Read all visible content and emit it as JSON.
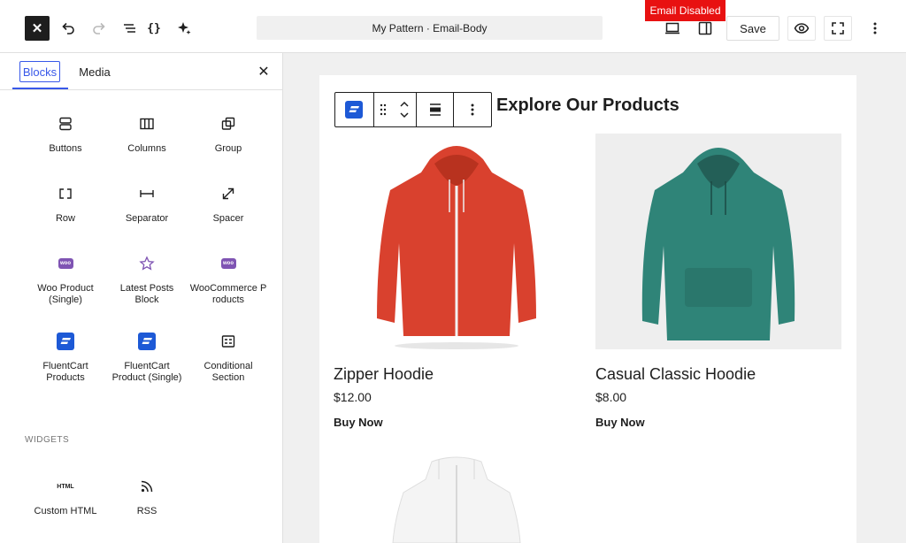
{
  "topbar": {
    "close_icon": "close-icon",
    "undo_icon": "undo-icon",
    "redo_icon": "redo-icon",
    "list_view_icon": "list-view-icon",
    "code_icon": "code-icon",
    "ai_icon": "sparkle-icon",
    "document_title": "My Pattern · Email-Body",
    "email_status": "Email Disabled",
    "save_label": "Save",
    "accent": "#3858e9",
    "status_color": "#e81111"
  },
  "sidebar": {
    "tabs": [
      {
        "label": "Blocks",
        "active": true
      },
      {
        "label": "Media",
        "active": false
      }
    ],
    "blocks": [
      {
        "label": "Buttons",
        "icon": "buttons-icon"
      },
      {
        "label": "Columns",
        "icon": "columns-icon"
      },
      {
        "label": "Group",
        "icon": "group-icon"
      },
      {
        "label": "Row",
        "icon": "row-icon"
      },
      {
        "label": "Separator",
        "icon": "separator-icon"
      },
      {
        "label": "Spacer",
        "icon": "spacer-icon"
      },
      {
        "label": "Woo Product (Single)",
        "icon": "woo-icon"
      },
      {
        "label": "Latest Posts Block",
        "icon": "star-icon"
      },
      {
        "label": "WooCommerce Products",
        "icon": "woo-icon"
      },
      {
        "label": "FluentCart Products",
        "icon": "fluentcart-icon"
      },
      {
        "label": "FluentCart Product (Single)",
        "icon": "fluentcart-icon"
      },
      {
        "label": "Conditional Section",
        "icon": "conditional-icon"
      }
    ],
    "widgets_heading": "WIDGETS",
    "widgets": [
      {
        "label": "Custom HTML",
        "icon_text": "HTML"
      },
      {
        "label": "RSS",
        "icon": "rss-icon"
      }
    ]
  },
  "canvas": {
    "heading": "Explore Our Products",
    "products": [
      {
        "name": "Zipper Hoodie",
        "price": "$12.00",
        "cta": "Buy Now",
        "color": "#d9412e"
      },
      {
        "name": "Casual Classic Hoodie",
        "price": "$8.00",
        "cta": "Buy Now",
        "color": "#2f8478"
      }
    ]
  }
}
